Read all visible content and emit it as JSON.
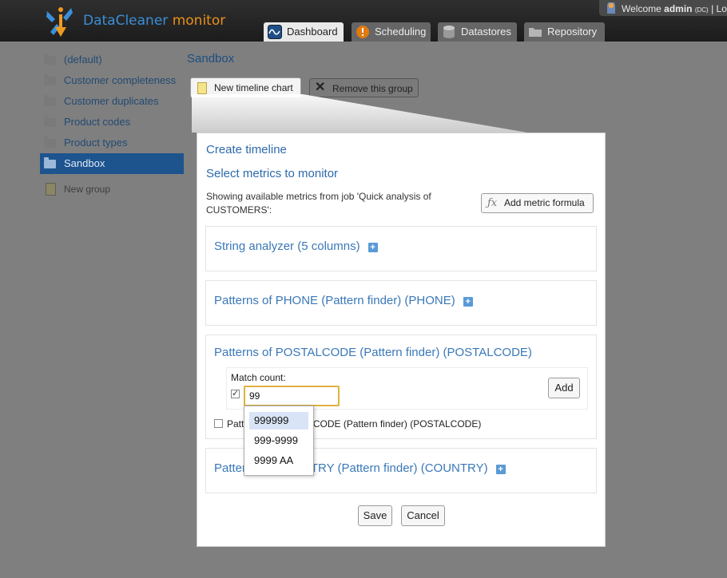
{
  "header": {
    "brand_main": "DataCleaner",
    "brand_sub": "monitor",
    "welcome_prefix": "Welcome",
    "user_name": "admin",
    "user_tenant": "(DC)",
    "logout_fragment": "| Lo"
  },
  "tabs": [
    {
      "label": "Dashboard",
      "icon": "dashboard-icon",
      "active": true
    },
    {
      "label": "Scheduling",
      "icon": "scheduling-icon",
      "active": false
    },
    {
      "label": "Datastores",
      "icon": "datastores-icon",
      "active": false
    },
    {
      "label": "Repository",
      "icon": "repository-icon",
      "active": false
    }
  ],
  "sidebar": {
    "items": [
      {
        "label": "(default)"
      },
      {
        "label": "Customer completeness"
      },
      {
        "label": "Customer duplicates"
      },
      {
        "label": "Product codes"
      },
      {
        "label": "Product types"
      },
      {
        "label": "Sandbox"
      }
    ],
    "active_index": 5,
    "new_group": "New group"
  },
  "main": {
    "title": "Sandbox",
    "new_chart_label": "New timeline chart",
    "remove_group_label": "Remove this group"
  },
  "dialog": {
    "title": "Create timeline",
    "subtitle": "Select metrics to monitor",
    "description": "Showing available metrics from job 'Quick analysis of CUSTOMERS':",
    "add_formula_label": "Add metric formula",
    "sections": [
      {
        "title": "String analyzer (5 columns)"
      },
      {
        "title": "Patterns of PHONE (Pattern finder) (PHONE)"
      },
      {
        "title": "Patterns of POSTALCODE (Pattern finder) (POSTALCODE)"
      },
      {
        "title": "Patterns of COUNTRY (Pattern finder) (COUNTRY)"
      }
    ],
    "match_count_label": "Match count:",
    "match_input_value": "99",
    "add_label": "Add",
    "partial_checkbox_label": "Patterns of POSTALCODE (Pattern finder) (POSTALCODE)",
    "autocomplete": [
      "999999",
      "999-9999",
      "9999 AA"
    ],
    "save_label": "Save",
    "cancel_label": "Cancel"
  },
  "colors": {
    "accent": "#2d6aac",
    "sidebar_active": "#1d548e",
    "brand_orange": "#e8901a",
    "input_focus": "#e0b040"
  }
}
